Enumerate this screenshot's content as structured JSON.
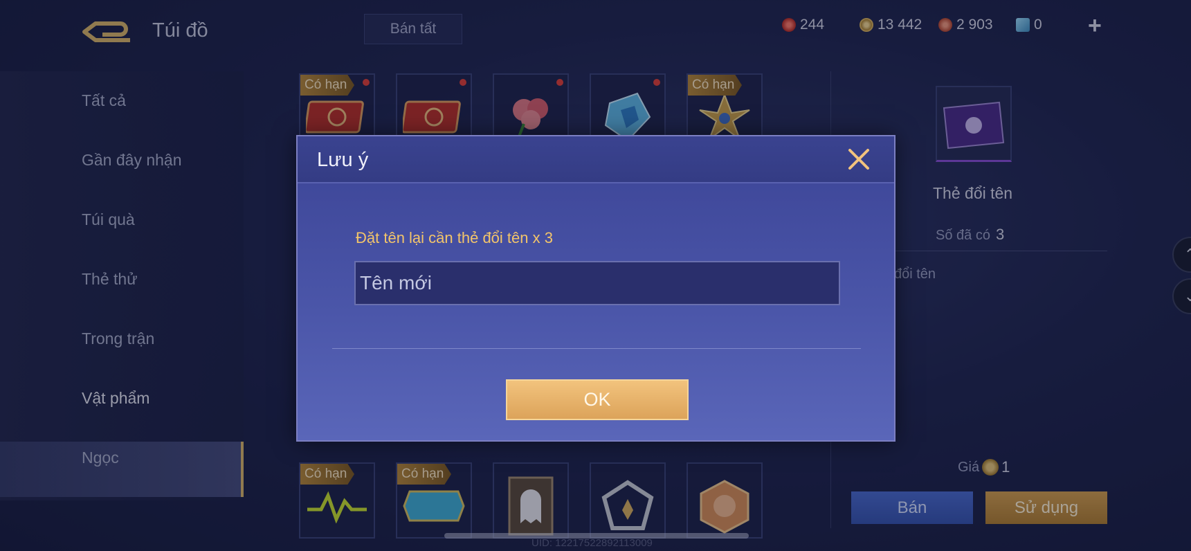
{
  "header": {
    "title": "Túi đồ",
    "sell_all_label": "Bán tất",
    "currencies": [
      {
        "icon": "red-gem-icon",
        "value": "244",
        "color": "#d8403a"
      },
      {
        "icon": "gold-coin-icon",
        "value": "13 442",
        "color": "#d7b15c"
      },
      {
        "icon": "ruby-icon",
        "value": "2 903",
        "color": "#d7624e"
      },
      {
        "icon": "voucher-card-icon",
        "value": "0",
        "color": "#7fc3e8"
      }
    ]
  },
  "sidebar": {
    "items": [
      {
        "label": "Tất cả"
      },
      {
        "label": "Gần đây nhận"
      },
      {
        "label": "Túi quà"
      },
      {
        "label": "Thẻ thử"
      },
      {
        "label": "Trong trận"
      },
      {
        "label": "Vật phẩm",
        "active": true
      },
      {
        "label": "Ngọc"
      }
    ]
  },
  "grid": {
    "top_row": [
      {
        "tag": "Có hạn",
        "new": true,
        "icon": "red-ticket-icon"
      },
      {
        "tag": "",
        "new": true,
        "icon": "red-ticket-icon"
      },
      {
        "tag": "",
        "new": true,
        "icon": "rose-icon"
      },
      {
        "tag": "",
        "new": true,
        "icon": "crystal-icon"
      },
      {
        "tag": "Có hạn",
        "new": false,
        "icon": "golden-emblem-icon"
      }
    ],
    "bottom_row": [
      {
        "tag": "Có hạn",
        "icon": "pulse-icon"
      },
      {
        "tag": "Có hạn",
        "icon": "badge-2025-icon"
      },
      {
        "tag": "",
        "icon": "ghost-card-icon"
      },
      {
        "tag": "",
        "icon": "rank-emblem-icon"
      },
      {
        "tag": "",
        "icon": "hero-portrait-icon"
      }
    ]
  },
  "detail": {
    "item_name": "Thẻ đổi tên",
    "owned_label": "Số đã có",
    "owned_value": "3",
    "description_tail": "đổi tên",
    "price_label": "Giá",
    "price_value": "1",
    "sell_label": "Bán",
    "use_label": "Sử dụng"
  },
  "modal": {
    "title": "Lưu ý",
    "message": "Đặt tên lại cần thẻ đổi tên x 3",
    "input_placeholder": "Tên mới",
    "input_value": "",
    "ok_label": "OK"
  },
  "footer": {
    "uid": "UID: 12217522892113009"
  }
}
